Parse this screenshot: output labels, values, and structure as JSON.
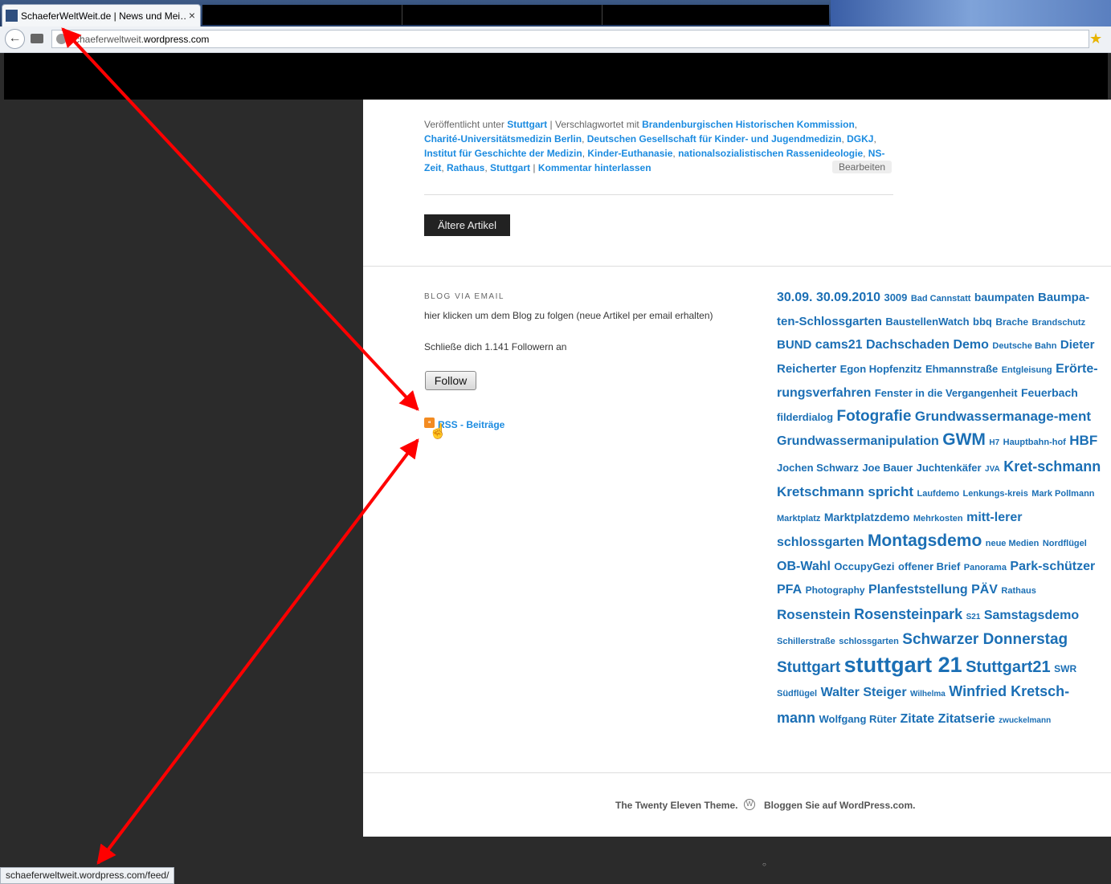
{
  "browser": {
    "tab_title": "SchaeferWeltWeit.de | News und Mei…",
    "tab_close": "×",
    "url_prefix": "schaeferweltweit.",
    "url_domain": "wordpress.com",
    "status_url": "schaeferweltweit.wordpress.com/feed/"
  },
  "post_meta": {
    "published_under": "Veröffentlicht unter",
    "category": "Stuttgart",
    "sep1": "|",
    "tagged_with": "Verschlagwortet mit",
    "tags": [
      "Brandenburgischen Historischen Kommission",
      "Charité-Universitätsmedizin Berlin",
      "Deutschen Gesellschaft für Kinder- und Jugendmedizin",
      "DGKJ",
      "Institut für Geschichte der Medizin",
      "Kinder-Euthanasie",
      "nationalsozialistischen Rassenideologie",
      "NS-Zeit",
      "Rathaus",
      "Stuttgart"
    ],
    "comment_link": "Kommentar hinterlassen",
    "edit_label": "Bearbeiten"
  },
  "nav": {
    "older_label": "Ältere Artikel"
  },
  "widget_email": {
    "title": "BLOG VIA EMAIL",
    "description": "hier klicken um dem Blog zu folgen (neue Artikel per email erhalten)",
    "followers": "Schließe dich 1.141 Followern an",
    "follow_label": "Follow"
  },
  "rss": {
    "link_label": "RSS - Beiträge"
  },
  "tag_cloud": [
    {
      "t": "30.09.",
      "s": 16
    },
    {
      "t": "30.09.2010",
      "s": 16
    },
    {
      "t": "3009",
      "s": 13
    },
    {
      "t": "Bad Cannstatt",
      "s": 11
    },
    {
      "t": "baumpaten",
      "s": 14
    },
    {
      "t": "Baumpa-ten-Schlossgarten",
      "s": 15
    },
    {
      "t": "BaustellenWatch",
      "s": 13
    },
    {
      "t": "bbq",
      "s": 13
    },
    {
      "t": "Brache",
      "s": 12
    },
    {
      "t": "Brandschutz",
      "s": 11
    },
    {
      "t": "BUND",
      "s": 15
    },
    {
      "t": "cams21",
      "s": 16
    },
    {
      "t": "Dachschaden",
      "s": 16
    },
    {
      "t": "Demo",
      "s": 16
    },
    {
      "t": "Deutsche Bahn",
      "s": 11
    },
    {
      "t": "Dieter Reicherter",
      "s": 15
    },
    {
      "t": "Egon Hopfenzitz",
      "s": 13
    },
    {
      "t": "Ehmannstraße",
      "s": 13
    },
    {
      "t": "Entgleisung",
      "s": 11
    },
    {
      "t": "Erörte-rungsverfahren",
      "s": 16
    },
    {
      "t": "Fenster in die Vergangenheit",
      "s": 13
    },
    {
      "t": "Feuerbach",
      "s": 14
    },
    {
      "t": "filderdialog",
      "s": 13
    },
    {
      "t": "Fotografie",
      "s": 19
    },
    {
      "t": "Grundwassermanage-ment",
      "s": 17
    },
    {
      "t": "Grundwassermanipulation",
      "s": 16
    },
    {
      "t": "GWM",
      "s": 21
    },
    {
      "t": "H7",
      "s": 10
    },
    {
      "t": "Hauptbahn-hof",
      "s": 11
    },
    {
      "t": "HBF",
      "s": 17
    },
    {
      "t": "Jochen Schwarz",
      "s": 13
    },
    {
      "t": "Joe Bauer",
      "s": 13
    },
    {
      "t": "Juchtenkäfer",
      "s": 13
    },
    {
      "t": "JVA",
      "s": 10
    },
    {
      "t": "Kret-schmann",
      "s": 18
    },
    {
      "t": "Kretschmann spricht",
      "s": 17
    },
    {
      "t": "Laufdemo",
      "s": 11
    },
    {
      "t": "Lenkungs-kreis",
      "s": 11
    },
    {
      "t": "Mark Pollmann",
      "s": 11
    },
    {
      "t": "Marktplatz",
      "s": 11
    },
    {
      "t": "Marktplatzdemo",
      "s": 14
    },
    {
      "t": "Mehrkosten",
      "s": 11
    },
    {
      "t": "mitt-lerer schlossgarten",
      "s": 16
    },
    {
      "t": "Montagsdemo",
      "s": 21
    },
    {
      "t": "neue Medien",
      "s": 11
    },
    {
      "t": "Nordflügel",
      "s": 11
    },
    {
      "t": "OB-Wahl",
      "s": 16
    },
    {
      "t": "OccupyGezi",
      "s": 13
    },
    {
      "t": "offener Brief",
      "s": 13
    },
    {
      "t": "Panorama",
      "s": 11
    },
    {
      "t": "Park-schützer",
      "s": 16
    },
    {
      "t": "PFA",
      "s": 16
    },
    {
      "t": "Photography",
      "s": 12
    },
    {
      "t": "Planfeststellung",
      "s": 16
    },
    {
      "t": "PÄV",
      "s": 16
    },
    {
      "t": "Rathaus",
      "s": 11
    },
    {
      "t": "Rosenstein",
      "s": 17
    },
    {
      "t": "Rosensteinpark",
      "s": 18
    },
    {
      "t": "S21",
      "s": 10
    },
    {
      "t": "Samstagsdemo",
      "s": 16
    },
    {
      "t": "Schillerstraße",
      "s": 11
    },
    {
      "t": "schlossgarten",
      "s": 11
    },
    {
      "t": "Schwarzer Donnerstag",
      "s": 19
    },
    {
      "t": "Stuttgart",
      "s": 19
    },
    {
      "t": "stuttgart 21",
      "s": 27
    },
    {
      "t": "Stuttgart21",
      "s": 20
    },
    {
      "t": "SWR",
      "s": 12
    },
    {
      "t": "Südflügel",
      "s": 11
    },
    {
      "t": "Walter Steiger",
      "s": 16
    },
    {
      "t": "Wilhelma",
      "s": 10
    },
    {
      "t": "Winfried Kretsch-mann",
      "s": 18
    },
    {
      "t": "Wolfgang Rüter",
      "s": 13
    },
    {
      "t": "Zitate",
      "s": 16
    },
    {
      "t": "Zitatserie",
      "s": 16
    },
    {
      "t": "zwuckelmann",
      "s": 10
    }
  ],
  "footer": {
    "theme_credit": "The Twenty Eleven Theme.",
    "wp_credit": "Bloggen Sie auf WordPress.com."
  },
  "colors": {
    "link": "#1b8be0",
    "tag": "#1b6fb5",
    "annotation_arrow": "#ff0000"
  }
}
